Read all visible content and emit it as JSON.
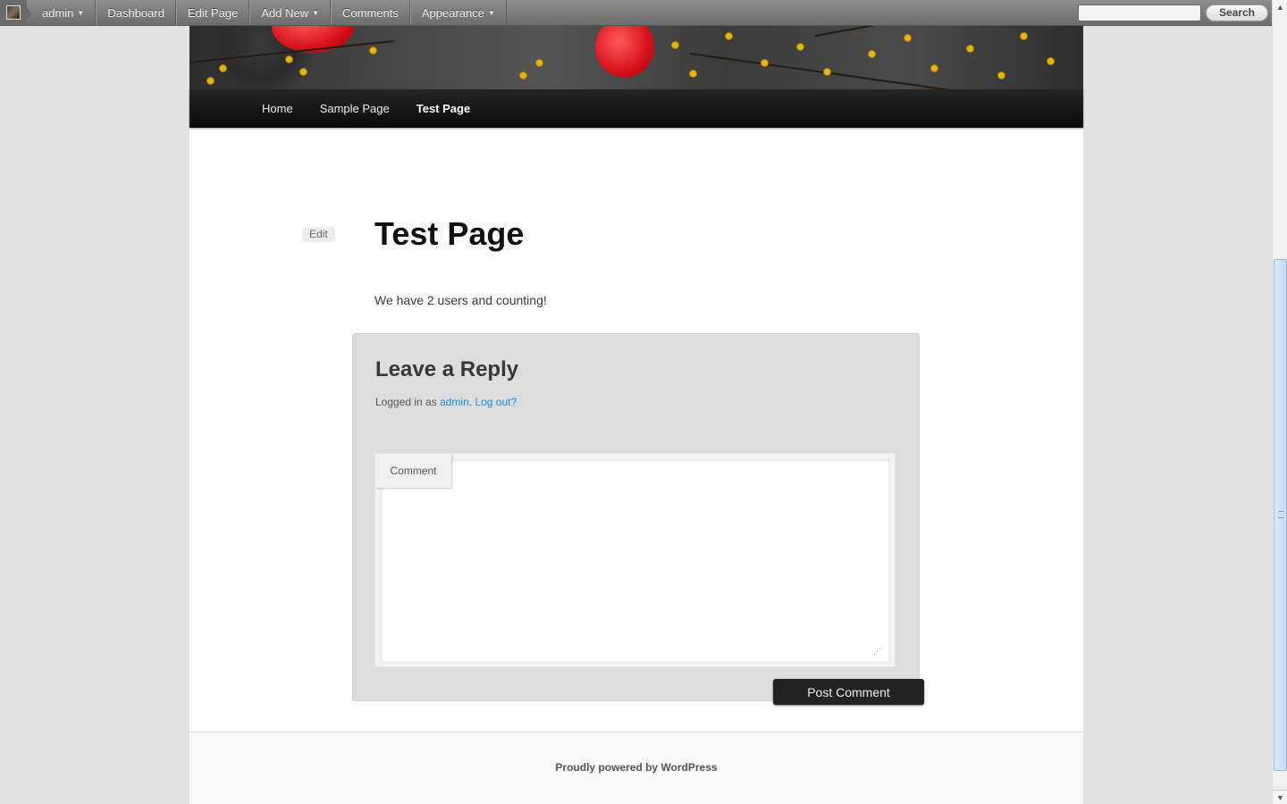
{
  "admin_bar": {
    "user": "admin",
    "items": [
      "Dashboard",
      "Edit Page",
      "Add New",
      "Comments",
      "Appearance"
    ],
    "search_button": "Search",
    "search_placeholder": ""
  },
  "nav": {
    "items": [
      "Home",
      "Sample Page",
      "Test Page"
    ],
    "current": "Test Page"
  },
  "page": {
    "edit_label": "Edit",
    "title": "Test Page",
    "content": "We have 2 users and counting!"
  },
  "comments": {
    "heading": "Leave a Reply",
    "logged_in_prefix": "Logged in as",
    "user_link": "admin",
    "separator": ".",
    "logout_link": "Log out?",
    "comment_label": "Comment",
    "comment_value": "",
    "submit_label": "Post Comment"
  },
  "footer": {
    "text": "Proudly powered by WordPress"
  },
  "colors": {
    "link": "#1b8be0",
    "nav_background": "#111111",
    "page_background": "#e2e2e2"
  }
}
